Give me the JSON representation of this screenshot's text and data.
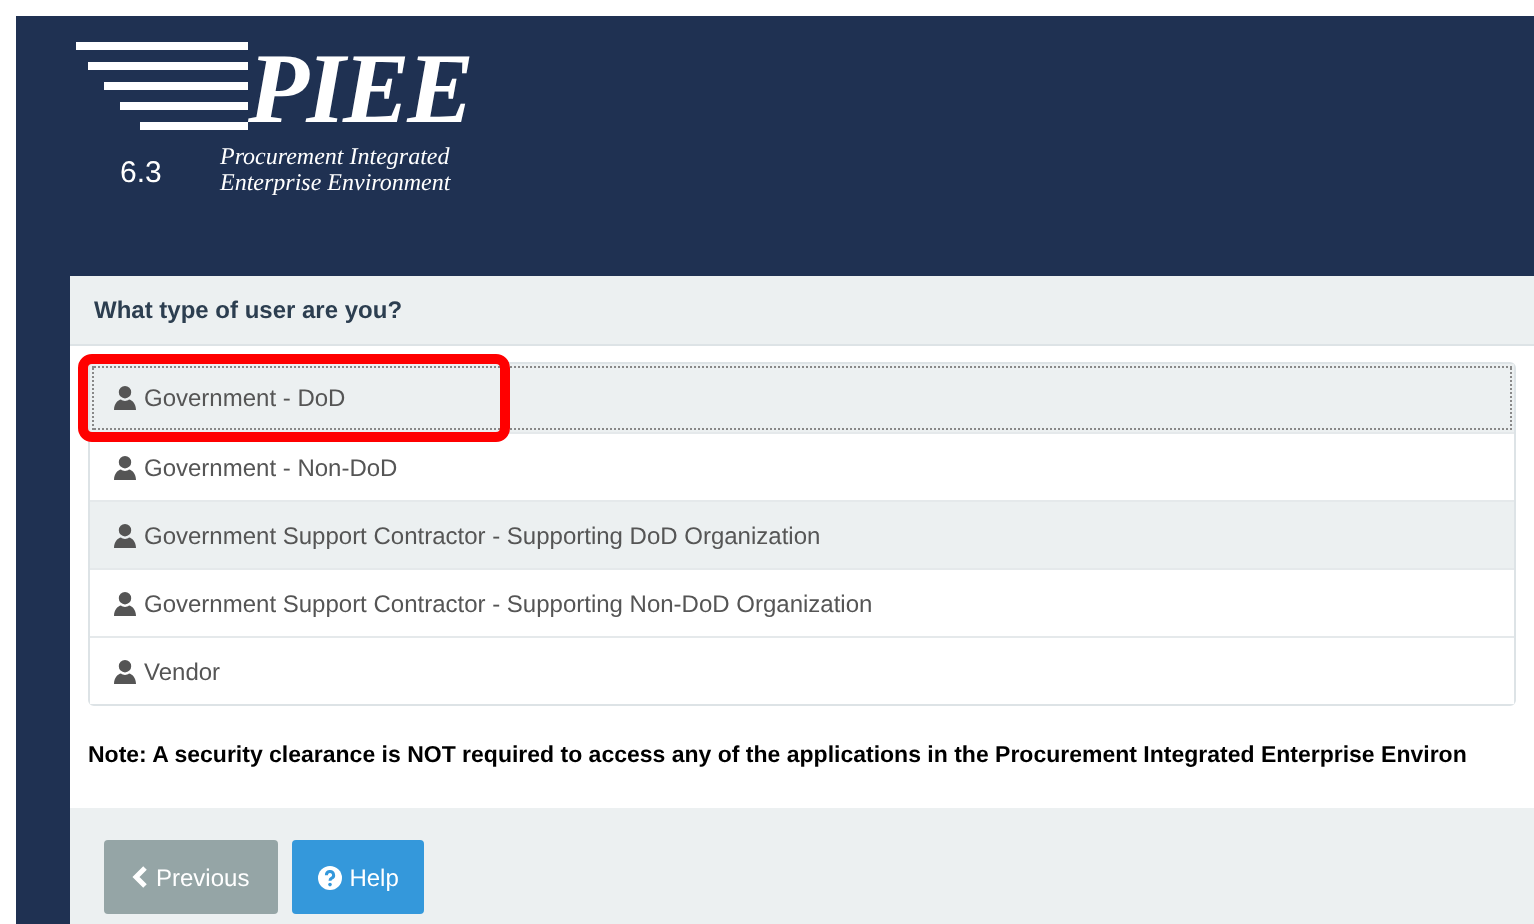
{
  "header": {
    "logo": "PIEE",
    "version": "6.3",
    "tagline_1": "Procurement Integrated",
    "tagline_2": "Enterprise Environment"
  },
  "panel": {
    "title": "What type of user are you?",
    "options": [
      {
        "label": "Government - DoD",
        "selected": true,
        "shaded": true,
        "circled": true
      },
      {
        "label": "Government - Non-DoD",
        "selected": false,
        "shaded": false,
        "circled": false
      },
      {
        "label": "Government Support Contractor - Supporting DoD Organization",
        "selected": false,
        "shaded": true,
        "circled": false
      },
      {
        "label": "Government Support Contractor - Supporting Non-DoD Organization",
        "selected": false,
        "shaded": false,
        "circled": false
      },
      {
        "label": "Vendor",
        "selected": false,
        "shaded": false,
        "circled": false
      }
    ],
    "note": "Note: A security clearance is NOT required to access any of the applications in the Procurement Integrated Enterprise Environ"
  },
  "buttons": [
    {
      "kind": "previous",
      "label": "Previous"
    },
    {
      "kind": "help",
      "label": "Help"
    }
  ]
}
